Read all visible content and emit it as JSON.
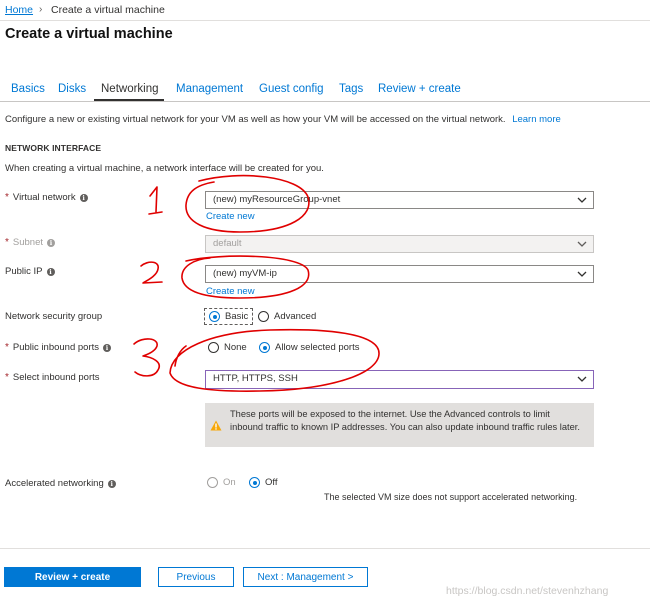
{
  "breadcrumb": {
    "home": "Home",
    "sep": "›",
    "current": "Create a virtual machine"
  },
  "page_title": "Create a virtual machine",
  "tabs": [
    {
      "label": "Basics",
      "active": false
    },
    {
      "label": "Disks",
      "active": false
    },
    {
      "label": "Networking",
      "active": true
    },
    {
      "label": "Management",
      "active": false
    },
    {
      "label": "Guest config",
      "active": false
    },
    {
      "label": "Tags",
      "active": false
    },
    {
      "label": "Review + create",
      "active": false
    }
  ],
  "intro": {
    "text": "Configure a new or existing virtual network for your VM as well as how your VM will be accessed on the virtual network.",
    "learn_more": "Learn more"
  },
  "section": {
    "title": "NETWORK INTERFACE",
    "desc": "When creating a virtual machine, a network interface will be created for you."
  },
  "fields": {
    "vnet": {
      "required": "*",
      "label": "Virtual network",
      "value": "(new) myResourceGroup-vnet",
      "create_new": "Create new"
    },
    "subnet": {
      "required": "*",
      "label": "Subnet",
      "value": "default"
    },
    "public_ip": {
      "label": "Public IP",
      "value": "(new) myVM-ip",
      "create_new": "Create new"
    },
    "nsg": {
      "label": "Network security group",
      "options": [
        "Basic",
        "Advanced"
      ],
      "selected": "Basic"
    },
    "inbound": {
      "required": "*",
      "label": "Public inbound ports",
      "options": [
        "None",
        "Allow selected ports"
      ],
      "selected": "Allow selected ports"
    },
    "select_ports": {
      "required": "*",
      "label": "Select inbound ports",
      "value": "HTTP, HTTPS, SSH"
    },
    "warning": {
      "icon": "warning-icon",
      "text": "These ports will be exposed to the internet. Use the Advanced controls to limit inbound traffic to known IP addresses. You can also update inbound traffic rules later."
    },
    "accel": {
      "label": "Accelerated networking",
      "options": [
        "On",
        "Off"
      ],
      "selected": "Off",
      "note": "The selected VM size does not support accelerated networking."
    }
  },
  "buttons": {
    "review": "Review + create",
    "previous": "Previous",
    "next": "Next : Management >"
  },
  "watermark": "https://blog.csdn.net/stevenhzhang",
  "annotations": [
    "1",
    "2",
    "3"
  ],
  "colors": {
    "accent": "#0078d4",
    "required": "#a4262c",
    "ink": "#e00000",
    "warning": "#f7a707"
  }
}
